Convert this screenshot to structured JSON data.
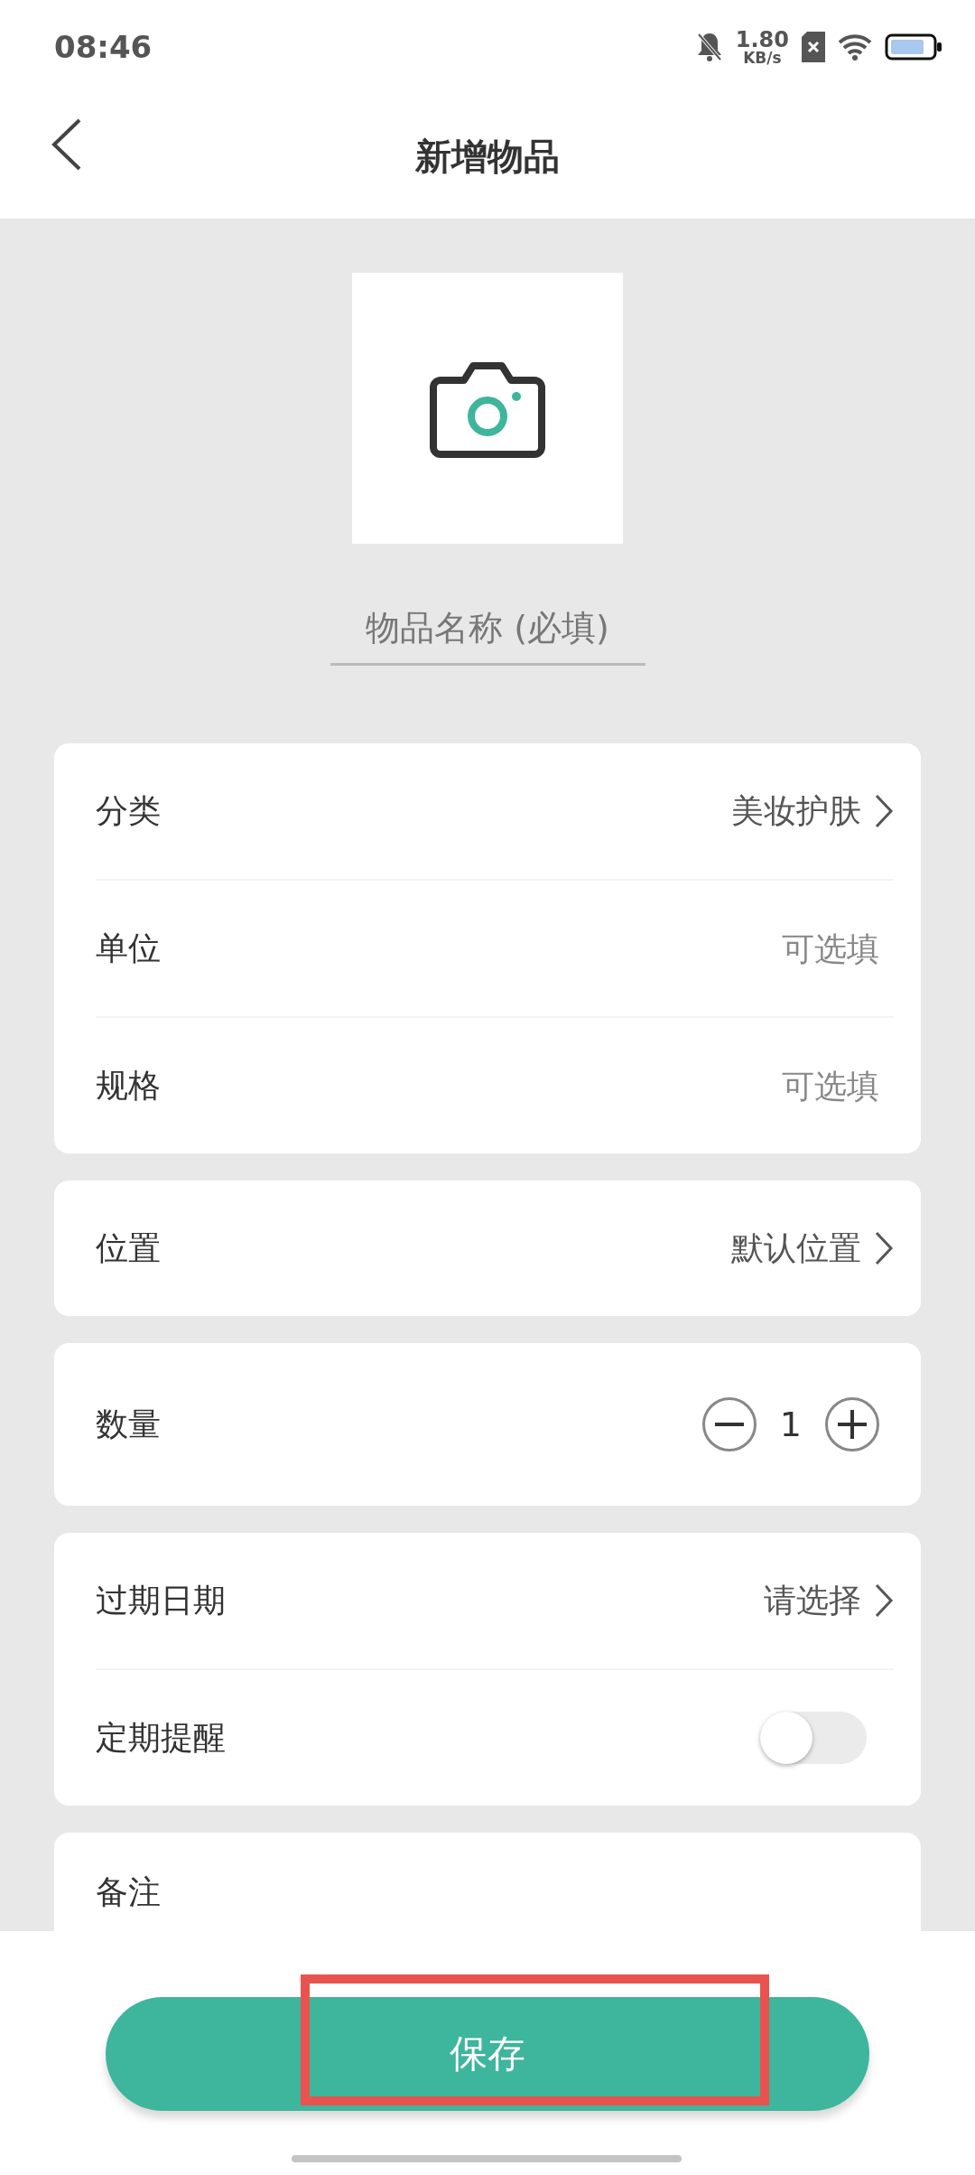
{
  "status_bar": {
    "time": "08:46",
    "speed_value": "1.80",
    "speed_unit": "KB/s"
  },
  "header": {
    "title": "新增物品"
  },
  "photo": {
    "kind": "camera"
  },
  "name_field": {
    "placeholder": "物品名称 (必填)"
  },
  "cards": [
    {
      "rows": [
        {
          "kind": "select",
          "label": "分类",
          "value": "美妆护肤"
        },
        {
          "kind": "input",
          "label": "单位",
          "placeholder": "可选填"
        },
        {
          "kind": "input",
          "label": "规格",
          "placeholder": "可选填"
        }
      ]
    },
    {
      "rows": [
        {
          "kind": "select",
          "label": "位置",
          "value": "默认位置"
        }
      ]
    },
    {
      "rows": [
        {
          "kind": "stepper",
          "label": "数量",
          "value": "1"
        }
      ]
    },
    {
      "rows": [
        {
          "kind": "select",
          "label": "过期日期",
          "value": "请选择"
        },
        {
          "kind": "switch",
          "label": "定期提醒",
          "on": false
        }
      ]
    },
    {
      "rows": [
        {
          "kind": "text",
          "label": "备注"
        }
      ]
    }
  ],
  "save_button": {
    "label": "保存",
    "highlighted": true
  }
}
